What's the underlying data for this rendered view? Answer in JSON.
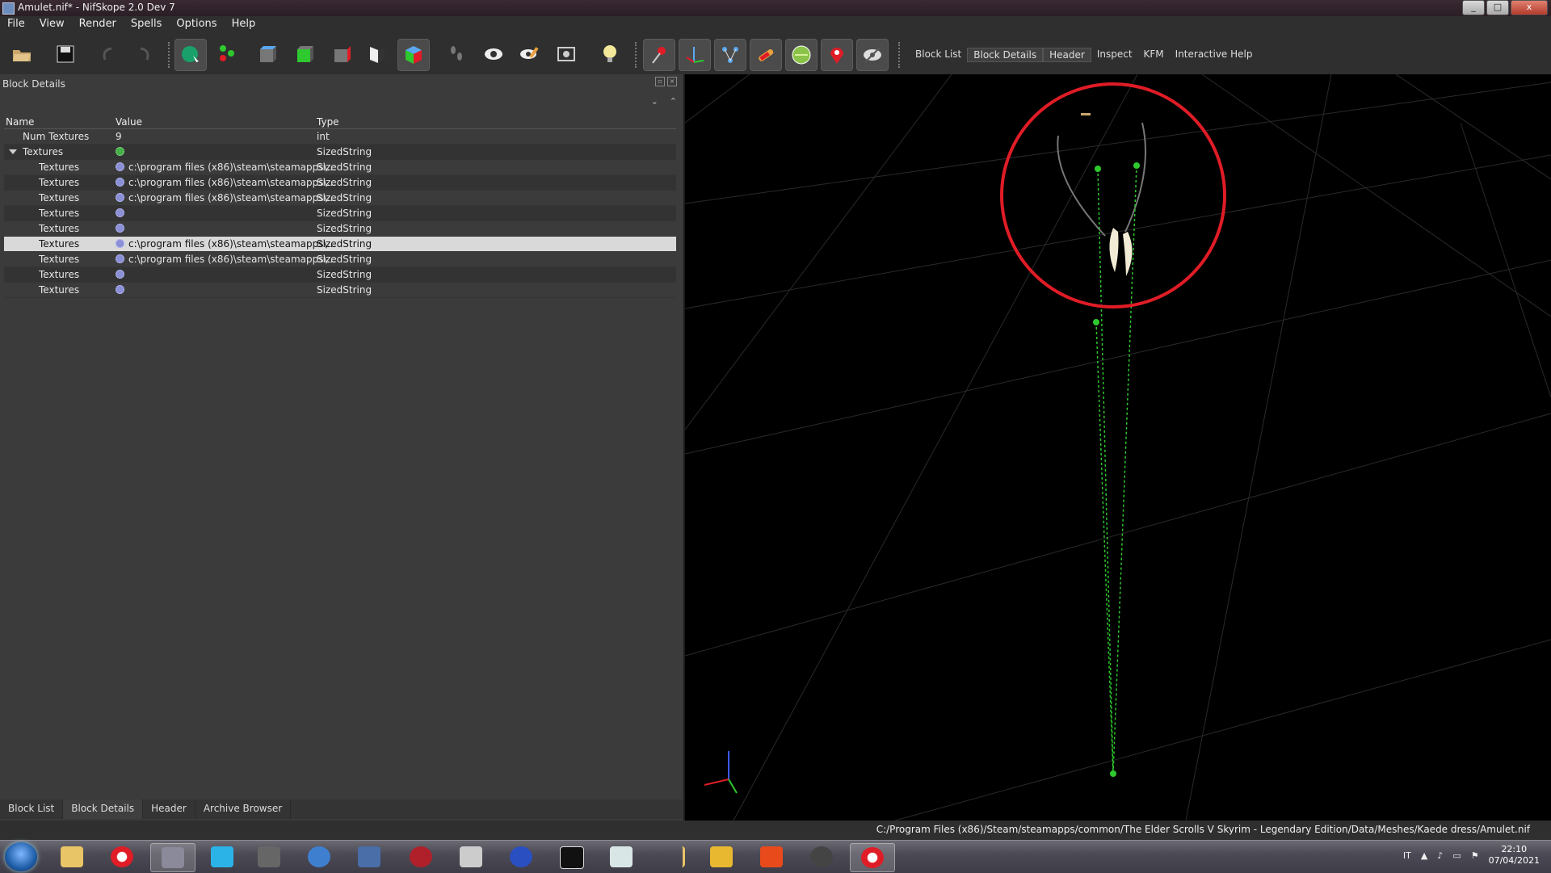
{
  "window": {
    "title": "Amulet.nif* - NifSkope 2.0 Dev 7",
    "controls": [
      "_",
      "□",
      "x"
    ]
  },
  "menu": [
    "File",
    "View",
    "Render",
    "Spells",
    "Options",
    "Help"
  ],
  "toolbar": {
    "links": [
      "Block List",
      "Block Details",
      "Header",
      "Inspect",
      "KFM",
      "Interactive Help"
    ],
    "active_link": "Block Details"
  },
  "block_details": {
    "title": "Block Details",
    "columns": {
      "name": "Name",
      "value": "Value",
      "type": "Type"
    },
    "rows": [
      {
        "name": "Num Textures",
        "value": "9",
        "type": "int",
        "icon": "none"
      },
      {
        "name": "Textures",
        "value": "",
        "type": "SizedString",
        "icon": "refresh-icon"
      },
      {
        "name": "Textures",
        "value": "c:\\program files (x86)\\steam\\steamapps\\...",
        "type": "SizedString",
        "icon": "gear-icon"
      },
      {
        "name": "Textures",
        "value": "c:\\program files (x86)\\steam\\steamapps\\...",
        "type": "SizedString",
        "icon": "gear-icon"
      },
      {
        "name": "Textures",
        "value": "c:\\program files (x86)\\steam\\steamapps\\...",
        "type": "SizedString",
        "icon": "gear-icon"
      },
      {
        "name": "Textures",
        "value": "",
        "type": "SizedString",
        "icon": "gear-icon"
      },
      {
        "name": "Textures",
        "value": "",
        "type": "SizedString",
        "icon": "gear-icon"
      },
      {
        "name": "Textures",
        "value": "c:\\program files (x86)\\steam\\steamapps\\...",
        "type": "SizedString",
        "icon": "gear-icon",
        "selected": true
      },
      {
        "name": "Textures",
        "value": "c:\\program files (x86)\\steam\\steamapps\\...",
        "type": "SizedString",
        "icon": "gear-icon"
      },
      {
        "name": "Textures",
        "value": "",
        "type": "SizedString",
        "icon": "gear-icon"
      },
      {
        "name": "Textures",
        "value": "",
        "type": "SizedString",
        "icon": "gear-icon"
      }
    ]
  },
  "bottom_tabs": [
    "Block List",
    "Block Details",
    "Header",
    "Archive Browser"
  ],
  "active_bottom_tab": "Block Details",
  "status": {
    "path": "C:/Program Files (x86)/Steam/steamapps/common/The Elder Scrolls V Skyrim - Legendary Edition/Data/Meshes/Kaede dress/Amulet.nif"
  },
  "taskbar": {
    "apps": [
      "file-explorer-icon",
      "opera-icon",
      "media-player-icon",
      "music-icon",
      "speaker-icon",
      "ffdec-icon",
      "pen-icon",
      "spider-icon",
      "network-icon",
      "headphones-icon",
      "nmm-icon",
      "window-icon",
      "arrow-icon",
      "archive-icon",
      "f-app-icon",
      "creation-kit-icon",
      "opera-icon"
    ],
    "lang": "IT",
    "time": "22:10",
    "date": "07/04/2021"
  },
  "colors": {
    "accent_green": "#2ec92e",
    "highlight_red": "#e01c26",
    "selection": "#d9d9d9"
  }
}
